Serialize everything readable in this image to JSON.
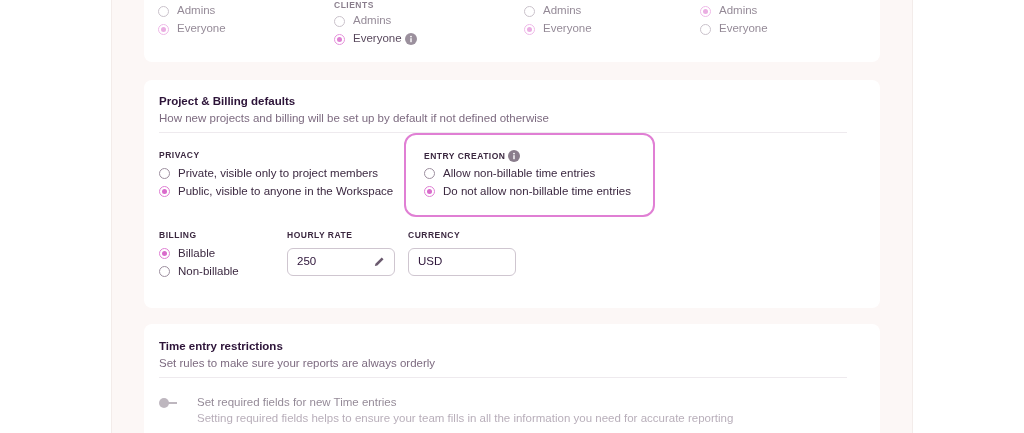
{
  "permission_columns": [
    {
      "options": [
        {
          "label": "Admins",
          "selected": false,
          "faded": true
        },
        {
          "label": "Everyone",
          "selected": true,
          "faded": true
        }
      ]
    },
    {
      "label": "CLIENTS",
      "options": [
        {
          "label": "Admins",
          "selected": false,
          "faded": true
        },
        {
          "label": "Everyone",
          "selected": true,
          "faded": false,
          "info": true
        }
      ]
    },
    {
      "options": [
        {
          "label": "Admins",
          "selected": false,
          "faded": true
        },
        {
          "label": "Everyone",
          "selected": true,
          "faded": true
        }
      ]
    },
    {
      "options": [
        {
          "label": "Admins",
          "selected": true,
          "faded": true
        },
        {
          "label": "Everyone",
          "selected": false,
          "faded": true
        }
      ]
    }
  ],
  "project_billing": {
    "title": "Project & Billing defaults",
    "subtitle": "How new projects and billing will be set up by default if not defined otherwise",
    "privacy": {
      "label": "PRIVACY",
      "options": [
        {
          "label": "Private, visible only to project members",
          "selected": false
        },
        {
          "label": "Public, visible to anyone in the Workspace",
          "selected": true
        }
      ]
    },
    "entry_creation": {
      "label": "ENTRY CREATION",
      "info": true,
      "highlighted": true,
      "options": [
        {
          "label": "Allow non-billable time entries",
          "selected": false
        },
        {
          "label": "Do not allow non-billable time entries",
          "selected": true
        }
      ]
    },
    "billing": {
      "label": "BILLING",
      "options": [
        {
          "label": "Billable",
          "selected": true
        },
        {
          "label": "Non-billable",
          "selected": false
        }
      ]
    },
    "hourly_rate": {
      "label": "HOURLY RATE",
      "value": "250"
    },
    "currency": {
      "label": "CURRENCY",
      "value": "USD"
    }
  },
  "time_entry_restrictions": {
    "title": "Time entry restrictions",
    "subtitle": "Set rules to make sure your reports are always orderly",
    "toggle": {
      "label": "Set required fields for new Time entries",
      "description": "Setting required fields helps to ensure your team fills in all the information you need for accurate reporting",
      "on": false
    }
  }
}
